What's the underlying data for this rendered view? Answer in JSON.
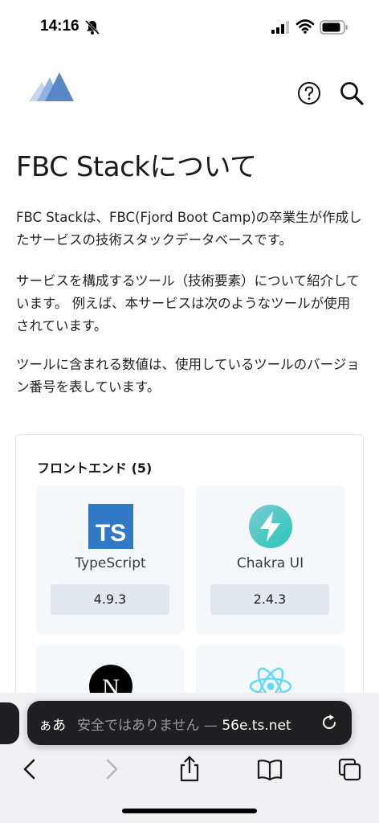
{
  "status_bar": {
    "time": "14:16",
    "icons": [
      "bell-slash-icon",
      "cellular-signal-icon",
      "wifi-icon",
      "battery-icon"
    ]
  },
  "header": {
    "logo": "fbc-stack-logo",
    "icons": [
      "help-icon",
      "search-icon"
    ]
  },
  "page": {
    "title": "FBC Stackについて",
    "paragraphs": [
      "FBC Stackは、FBC(Fjord Boot Camp)の卒業生が作成したサービスの技術スタックデータベースです。",
      "サービスを構成するツール（技術要素）について紹介しています。 例えば、本サービスは次のようなツールが使用されています。",
      "ツールに含まれる数値は、使用しているツールのバージョン番号を表しています。"
    ]
  },
  "frontend": {
    "heading": "フロントエンド (5)",
    "tools": [
      {
        "name": "TypeScript",
        "version": "4.9.3",
        "icon": "typescript-icon",
        "color": "#3178c6"
      },
      {
        "name": "Chakra UI",
        "version": "2.4.3",
        "icon": "chakra-ui-icon",
        "color": "#38c5bb"
      },
      {
        "name": "",
        "version": "",
        "icon": "nextjs-icon",
        "color": "#000000"
      },
      {
        "name": "",
        "version": "",
        "icon": "react-icon",
        "color": "#61dafb"
      }
    ]
  },
  "browser": {
    "aa_label": "ぁあ",
    "url_prefix": "安全ではありません — ",
    "url_domain": "56e.ts.net",
    "toolbar": [
      "back-icon",
      "forward-icon",
      "share-icon",
      "bookmarks-icon",
      "tabs-icon"
    ]
  },
  "colors": {
    "accent": "#3178c6",
    "card_bg": "#f5f8fb",
    "version_bg": "#e3e8ee"
  }
}
